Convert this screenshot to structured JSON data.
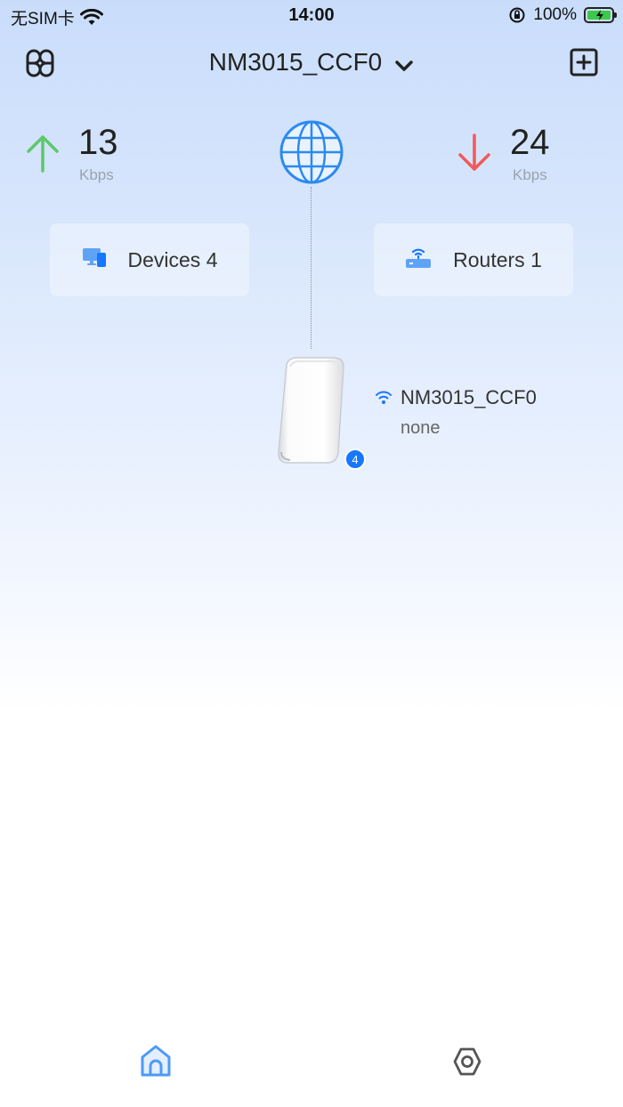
{
  "status_bar": {
    "carrier": "无SIM卡",
    "time": "14:00",
    "battery": "100%"
  },
  "header": {
    "network_name": "NM3015_CCF0",
    "icons": {
      "menu": "apps-grid-icon",
      "add": "add-square-icon",
      "dropdown": "chevron-down-icon"
    }
  },
  "speed": {
    "upload": {
      "value": "13",
      "unit": "Kbps",
      "icon": "arrow-up-icon",
      "color": "#5cc86a"
    },
    "download": {
      "value": "24",
      "unit": "Kbps",
      "icon": "arrow-down-icon",
      "color": "#f05a5a"
    }
  },
  "cards": {
    "devices": {
      "label": "Devices 4",
      "icon": "devices-icon"
    },
    "routers": {
      "label": "Routers 1",
      "icon": "router-icon"
    }
  },
  "topology": {
    "internet_icon": "globe-icon",
    "router": {
      "name": "NM3015_CCF0",
      "status": "none",
      "badge": "4",
      "wifi_icon": "wifi-icon"
    }
  },
  "tabbar": {
    "items": [
      {
        "icon": "home-icon",
        "active": true
      },
      {
        "icon": "settings-icon",
        "active": false
      }
    ]
  },
  "colors": {
    "accent": "#1677ff",
    "globe": "#2b8af0"
  }
}
